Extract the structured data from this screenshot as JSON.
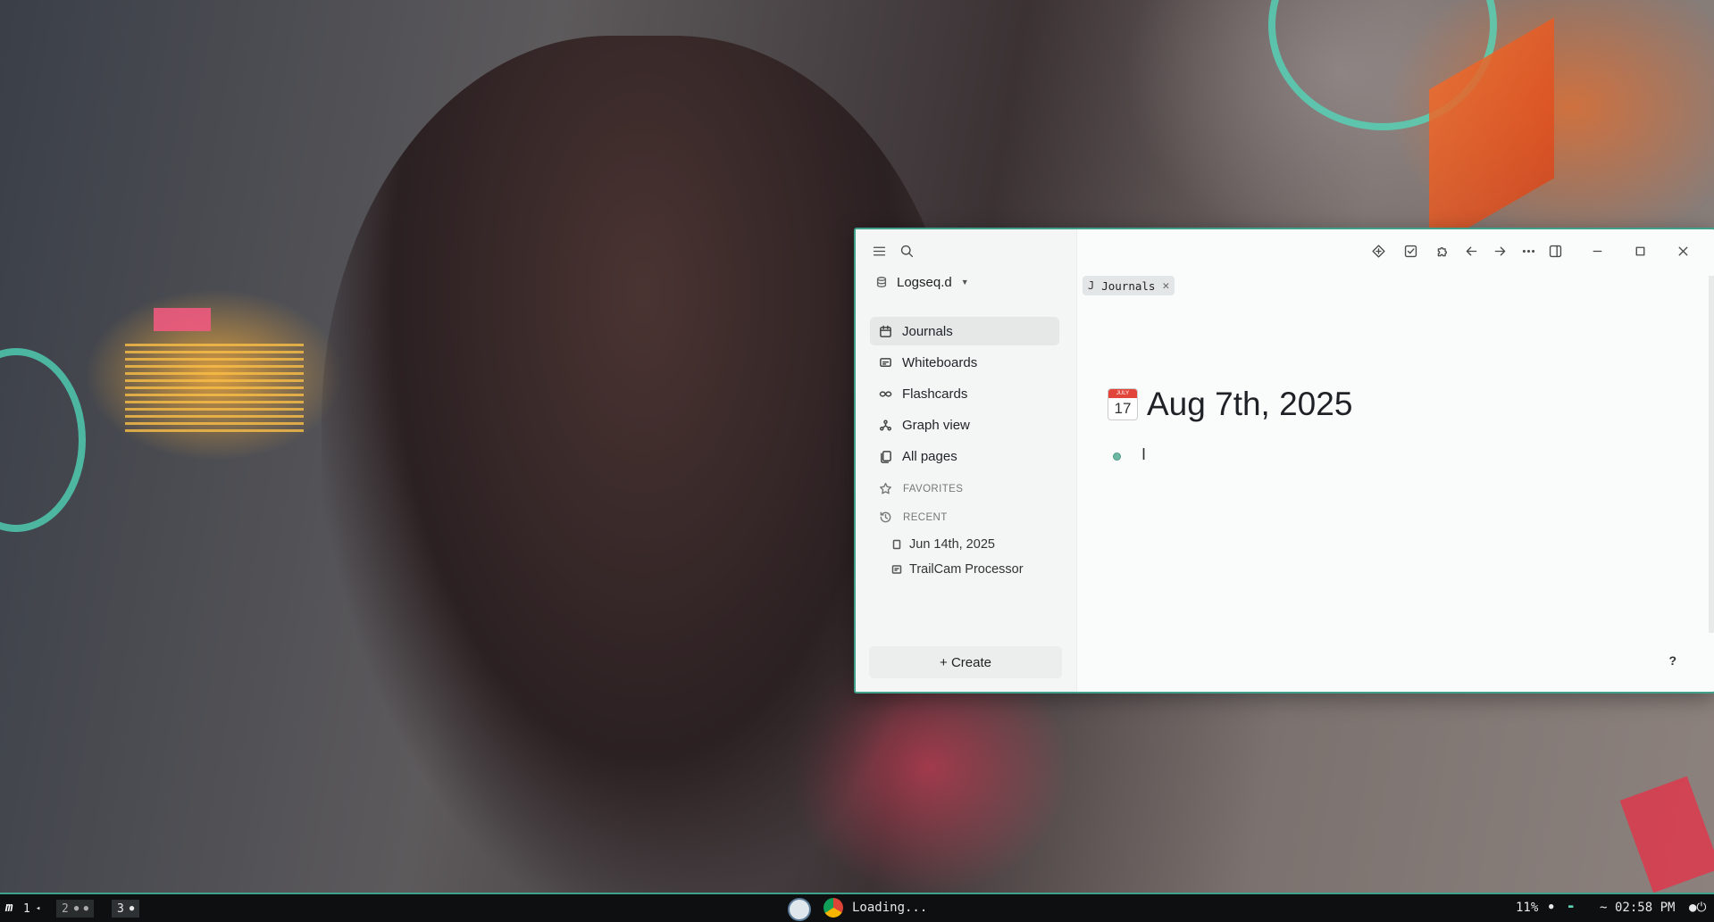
{
  "window": {
    "graph_name": "Logseq.d",
    "nav": [
      {
        "label": "Journals",
        "icon": "calendar-icon",
        "active": true
      },
      {
        "label": "Whiteboards",
        "icon": "whiteboard-icon",
        "active": false
      },
      {
        "label": "Flashcards",
        "icon": "infinity-icon",
        "active": false
      },
      {
        "label": "Graph view",
        "icon": "graph-icon",
        "active": false
      },
      {
        "label": "All pages",
        "icon": "pages-icon",
        "active": false
      }
    ],
    "favorites_label": "FAVORITES",
    "recent_label": "RECENT",
    "recent": [
      {
        "label": "Jun 14th, 2025",
        "icon": "page-icon"
      },
      {
        "label": "TrailCam Processor",
        "icon": "whiteboard-icon"
      }
    ],
    "create_label": "+ Create",
    "tab": {
      "letter": "J",
      "label": "Journals"
    },
    "journal": {
      "calendar_month": "JULY",
      "calendar_day": "17",
      "title": "Aug 7th, 2025"
    },
    "help_label": "?"
  },
  "taskbar": {
    "workspaces": [
      {
        "label": "1",
        "indicator": "◂"
      },
      {
        "label": "2",
        "indicator": "● ●"
      },
      {
        "label": "3",
        "indicator": "●"
      }
    ],
    "loading_label": "Loading...",
    "cpu": "11%",
    "tilde": "~",
    "clock": "02:58 PM"
  },
  "colors": {
    "accent": "#3fa08c",
    "bullet": "#6fb7a5",
    "taskbar": "#0d0f10"
  }
}
